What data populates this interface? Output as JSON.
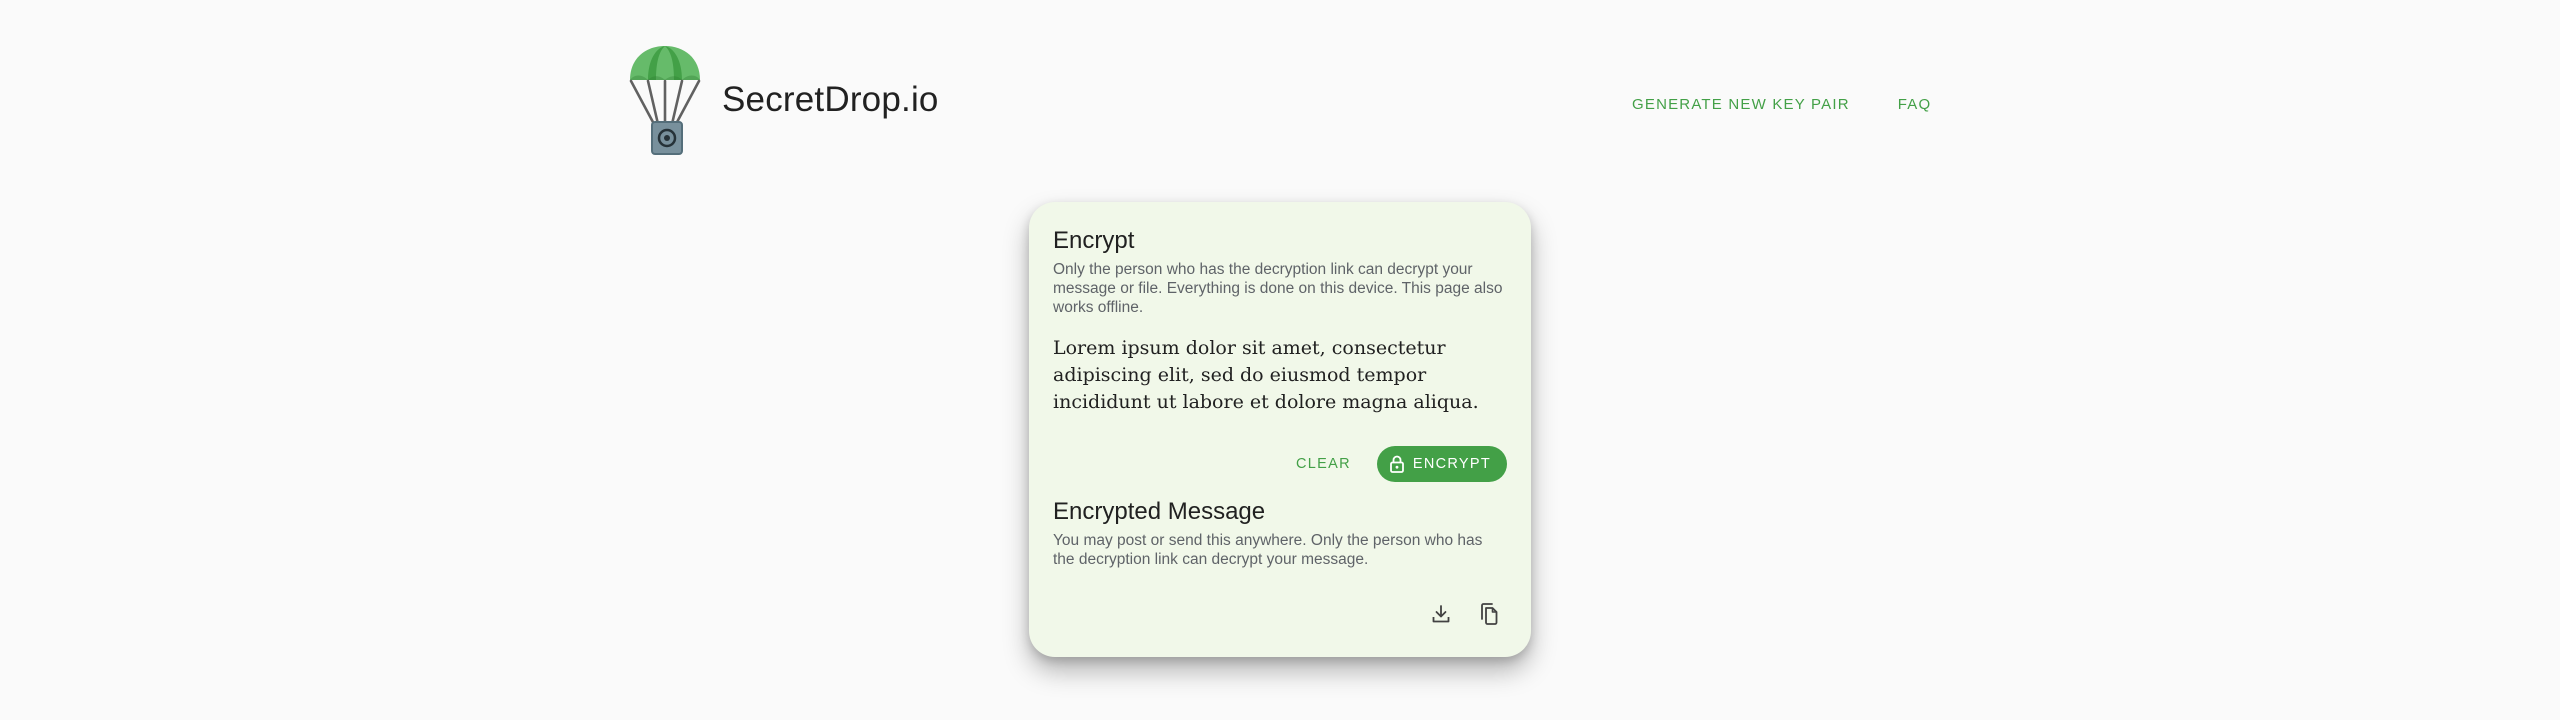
{
  "header": {
    "brand_name": "SecretDrop.io",
    "nav": [
      {
        "label": "GENERATE NEW KEY PAIR"
      },
      {
        "label": "FAQ"
      }
    ]
  },
  "encrypt": {
    "title": "Encrypt",
    "description": "Only the person who has the decryption link can decrypt your message or file. Everything is done on this device. This page also works offline.",
    "message_value": "Lorem ipsum dolor sit amet, consectetur adipiscing elit, sed do eiusmod tempor incididunt ut labore et dolore magna aliqua.",
    "clear_label": "CLEAR",
    "encrypt_label": "ENCRYPT"
  },
  "encrypted": {
    "title": "Encrypted Message",
    "description": "You may post or send this anywhere. Only the person who has the decryption link can decrypt your message.",
    "icons": [
      "download-icon",
      "copy-icon"
    ]
  },
  "colors": {
    "accent": "#43a047",
    "card_bg": "#f1f8e9",
    "page_bg": "#fafafa"
  }
}
